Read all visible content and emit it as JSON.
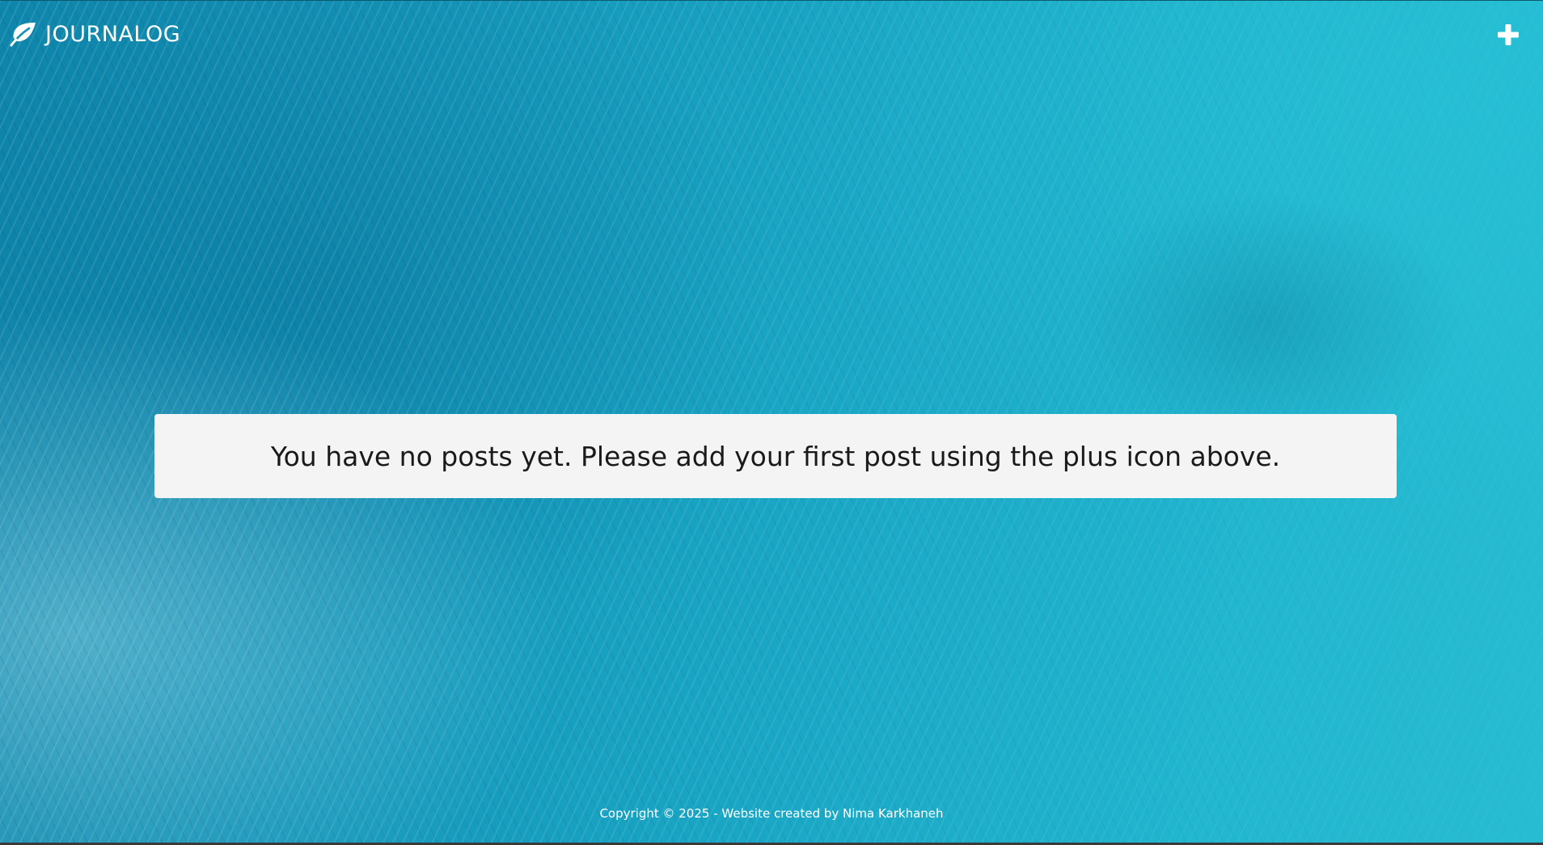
{
  "header": {
    "brand_icon": "leaf-icon",
    "brand_name": "JOURNALOG",
    "add_icon": "plus-icon"
  },
  "main": {
    "empty_message": "You have no posts yet. Please add your first post using the plus icon above."
  },
  "footer": {
    "copyright": "Copyright © 2025 - Website created by Nima Karkhaneh"
  },
  "colors": {
    "ocean_background": "#1aa3c2",
    "notice_background": "#f4f4f4",
    "header_text": "#ffffff",
    "notice_text": "#1a1a1a"
  }
}
